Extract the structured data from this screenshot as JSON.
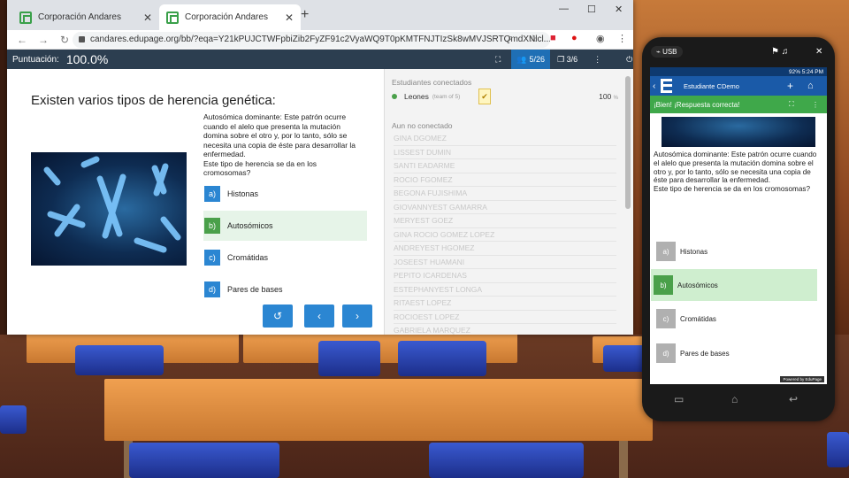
{
  "browser": {
    "tabs": [
      {
        "label": "Corporación Andares"
      },
      {
        "label": "Corporación Andares"
      }
    ],
    "url": "candares.edupage.org/bb/?eqa=Y21kPUJCTWFpbiZib2FyZF91c2VyaWQ9T0pKMTFNJTIzSk8wMVJSRTQmdXNlcl..."
  },
  "header": {
    "score_label": "Puntuación:",
    "score_value": "100.0%",
    "users_count": "5/26",
    "slides_count": "3/6"
  },
  "question": {
    "title": "Existen varios tipos de herencia genética:",
    "text": "Autosómica dominante: Este patrón ocurre cuando el alelo que presenta la mutación domina sobre el otro y, por lo tanto, sólo se necesita una copia de éste para desarrollar la enfermedad.\nEste tipo de herencia se da en los cromosomas?",
    "answers": [
      {
        "key": "a)",
        "text": "Histonas"
      },
      {
        "key": "b)",
        "text": "Autosómicos"
      },
      {
        "key": "c)",
        "text": "Cromátidas"
      },
      {
        "key": "d)",
        "text": "Pares de bases"
      }
    ]
  },
  "panel": {
    "connected_title": "Estudiantes conectados",
    "connected": {
      "name": "Leones",
      "team": "(team of 5)",
      "score": "100",
      "unit": "%"
    },
    "not_connected_title": "Aun no conectado",
    "students": [
      "GINA DGOMEZ",
      "LISSEST DUMIN",
      "SANTI EADARME",
      "ROCIO FGOMEZ",
      "BEGONA FUJISHIMA",
      "GIOVANNYEST GAMARRA",
      "MERYEST GOEZ",
      "GINA ROCIO GOMEZ LOPEZ",
      "ANDREYEST HGOMEZ",
      "JOSEEST HUAMANI",
      "PEPITO ICARDENAS",
      "ESTEPHANYEST LONGA",
      "RITAEST LOPEZ",
      "ROCIOEST LOPEZ",
      "GABRIELA MARQUEZ"
    ]
  },
  "phone": {
    "usb": "USB",
    "status": "92% 5:24 PM",
    "app_name": "Estudiante CDemo",
    "feedback": "¡Bien! ¡Respuesta correcta!",
    "footer": "Powered by EduPage"
  }
}
